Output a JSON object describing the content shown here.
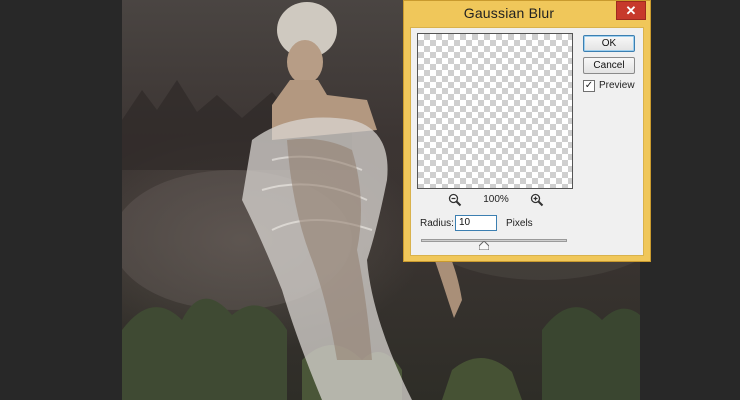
{
  "dialog": {
    "title": "Gaussian Blur",
    "close_label": "✕",
    "ok_label": "OK",
    "cancel_label": "Cancel",
    "preview_label": "Preview",
    "preview_checked": true,
    "zoom_level": "100%",
    "radius_label": "Radius:",
    "radius_value": "10",
    "radius_unit": "Pixels",
    "radius_slider_fraction": 0.43,
    "preview_icon": "transparency-checkerboard",
    "zoom_out_icon": "zoom-out-icon",
    "zoom_in_icon": "zoom-in-icon"
  },
  "colors": {
    "dialog_frame": "#f0c75a",
    "close_button": "#c7392b",
    "workspace": "#2b2b2b"
  }
}
